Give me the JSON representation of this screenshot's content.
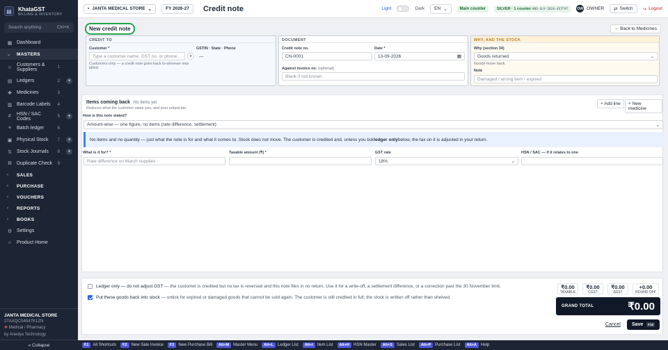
{
  "app": {
    "name": "KhataGST",
    "subtitle": "BILLING & INVENTORY"
  },
  "sidebar": {
    "search_placeholder": "Search anything",
    "search_shortcut": "Ctrl+K",
    "dashboard": "Dashboard",
    "masters_header": "MASTERS",
    "masters_items": [
      {
        "label": "Customers & Suppliers",
        "count": "1",
        "add": false
      },
      {
        "label": "Ledgers",
        "count": "2",
        "add": true
      },
      {
        "label": "Medicines",
        "count": "3",
        "add": false
      },
      {
        "label": "Barcode Labels",
        "count": "4",
        "add": false
      },
      {
        "label": "HSN / SAC Codes",
        "count": "5",
        "add": true
      },
      {
        "label": "Batch ledger",
        "count": "6",
        "add": false
      },
      {
        "label": "Physical Stock",
        "count": "7",
        "add": true
      },
      {
        "label": "Stock Journals",
        "count": "8",
        "add": true
      },
      {
        "label": "Duplicate Check",
        "count": "9",
        "add": false
      }
    ],
    "sections": [
      "SALES",
      "PURCHASE",
      "VOUCHERS",
      "REPORTS",
      "BOOKS"
    ],
    "settings": "Settings",
    "product_home": "Product Home",
    "shop_name": "JANTA MEDICAL STORE",
    "gstin": "27AAQCS4547K1ZN",
    "shop_type": "Medical / Pharmacy",
    "by": "by Anedya Technology",
    "collapse": "« Collapse"
  },
  "topbar": {
    "company": "JANTA MEDICAL STORE",
    "fy": "FY 2026-27",
    "title": "Credit note",
    "light": "Light",
    "dark": "Dark",
    "lang": "EN",
    "counter": "Main counter",
    "license": "SILVER · 1 counter",
    "license_code": "ANO-SLV-2026-4E7F97",
    "avatar": "OW",
    "role": "OWNER",
    "switch": "Switch",
    "logout": "Logout"
  },
  "form": {
    "badge": "New credit note",
    "back": "Back to Medicines",
    "credit_to": {
      "header": "CREDIT TO",
      "customer_label": "Customer *",
      "customer_placeholder": "Type a customer name, GST no. or phone...",
      "gstin_label": "GSTIN · State · Phone",
      "gstin_value": "—",
      "help": "Customers only — a credit note goes back to whoever was billed."
    },
    "document": {
      "header": "DOCUMENT",
      "no_label": "Credit note no.",
      "no_value": "CN-0001",
      "date_label": "Date *",
      "date_value": "13-09-2026",
      "against_label": "Against invoice no.",
      "against_opt": "(optional)",
      "against_placeholder": "Blank if not known"
    },
    "why": {
      "header": "WHY, AND THE STOCK",
      "reason_label": "Why (section 34)",
      "reason_value": "Goods returned",
      "reason_help": "Goods move back.",
      "note_label": "Note",
      "note_placeholder": "Damaged / wrong item / expired"
    }
  },
  "items": {
    "title": "Items coming back",
    "status": "No items yet",
    "sub": "Reduces what the customer owes you, and your output tax.",
    "add_line": "+ Add line",
    "new_medicine": "+ New medicine",
    "stated_label": "How is this note stated?",
    "stated_value": "Amount-wise — one figure, no items (rate difference, settlement)",
    "info_pre": "No items and no quantity — just what the note is for and what it comes to. Stock does not move. The customer is credited and, unless you tick ",
    "info_bold": "ledger only",
    "info_post": " below, the tax on it is adjusted in your return.",
    "what_label": "What is it for? *",
    "what_placeholder": "Rate difference on March supplies",
    "taxable_label": "Taxable amount (₹) *",
    "gst_label": "GST rate",
    "gst_value": "18%",
    "hsn_label": "HSN / SAC — if it relates to one"
  },
  "footer": {
    "ledger_only_title": "Ledger only — do not adjust GST",
    "ledger_only_desc": " — the customer is credited but no tax is reversed and this note files in no return. Use it for a write-off, a settlement difference, or a correction past the 30 November limit.",
    "stock_title": "Put these goods back into stock",
    "stock_desc": " — untick for expired or damaged goods that cannot be sold again. The customer is still credited in full; the stock is written off rather than shelved.",
    "taxable": "₹0.00",
    "taxable_l": "TAXABLE",
    "cgst": "₹0.00",
    "cgst_l": "CGST",
    "sgst": "₹0.00",
    "sgst_l": "SGST",
    "round": "+0.00",
    "round_l": "ROUND OFF",
    "grand_label": "GRAND TOTAL",
    "grand_value": "₹0.00",
    "cancel": "Cancel",
    "save": "Save",
    "save_key": "F10"
  },
  "statusbar": [
    {
      "key": "F1",
      "label": "All Shortcuts"
    },
    {
      "key": "F2",
      "label": "New Sale Invoice"
    },
    {
      "key": "F3",
      "label": "New Purchase Bill"
    },
    {
      "key": "Alt+M",
      "label": "Master Menu"
    },
    {
      "key": "Alt+L",
      "label": "Ledger List"
    },
    {
      "key": "Alt+I",
      "label": "Item List"
    },
    {
      "key": "Alt+H",
      "label": "HSN Master"
    },
    {
      "key": "Alt+S",
      "label": "Sales List"
    },
    {
      "key": "Alt+P",
      "label": "Purchase List"
    },
    {
      "key": "Alt+A",
      "label": "Help"
    }
  ]
}
